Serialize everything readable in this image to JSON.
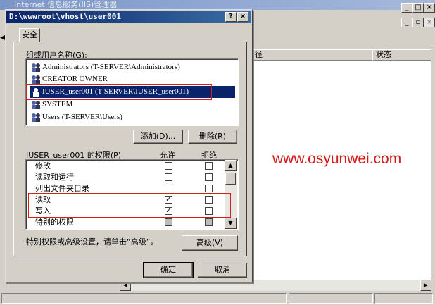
{
  "bg_window": {
    "title": "Internet 信息服务(IIS)管理器",
    "col_status": "状态",
    "col_path_fragment": "径"
  },
  "dialog": {
    "title": "D:\\wwwroot\\vhost\\user001",
    "help_btn": "?",
    "close_btn": "×",
    "tab": "安全",
    "users_label": "组或用户名称(G):",
    "users": [
      "Administrators (T-SERVER\\Administrators)",
      "CREATOR OWNER",
      "IUSER_user001 (T-SERVER\\IUSER_user001)",
      "SYSTEM",
      "Users (T-SERVER\\Users)"
    ],
    "selected_user_index": 2,
    "add_btn": "添加(D)...",
    "remove_btn": "删除(R)",
    "perm_label": "IUSER_user001 的权限(P)",
    "allow_header": "允许",
    "deny_header": "拒绝",
    "permissions": [
      {
        "name": "修改",
        "allow": false,
        "deny": false
      },
      {
        "name": "读取和运行",
        "allow": false,
        "deny": false
      },
      {
        "name": "列出文件夹目录",
        "allow": false,
        "deny": false
      },
      {
        "name": "读取",
        "allow": true,
        "deny": false
      },
      {
        "name": "写入",
        "allow": true,
        "deny": false
      },
      {
        "name": "特别的权限",
        "allow": false,
        "deny": false
      }
    ],
    "special_text": "特别权限或高级设置，请单击“高级”。",
    "advanced_btn": "高级(V)",
    "ok_btn": "确定",
    "cancel_btn": "取消"
  },
  "watermark": "www.osyunwei.com",
  "icons": [
    "user-group-icon",
    "check-icon",
    "scroll-up-icon",
    "scroll-down-icon"
  ],
  "colors": {
    "selection": "#0a246a",
    "highlight_box": "#d02020",
    "watermark": "#d81818"
  }
}
